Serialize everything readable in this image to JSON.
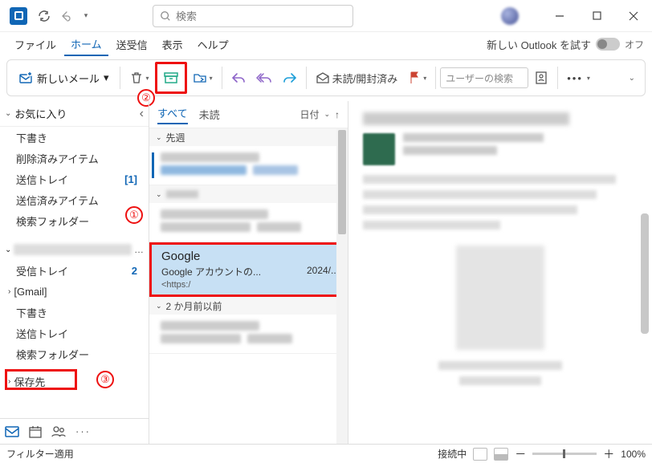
{
  "title": {
    "search_placeholder": "検索"
  },
  "menubar": {
    "file": "ファイル",
    "home": "ホーム",
    "sendrecv": "送受信",
    "view": "表示",
    "help": "ヘルプ",
    "try_new": "新しい Outlook を試す",
    "toggle_off": "オフ"
  },
  "ribbon": {
    "new_mail": "新しいメール",
    "unread_read": "未読/開封済み",
    "user_search_placeholder": "ユーザーの検索"
  },
  "sidebar": {
    "favorites": "お気に入り",
    "items_fav": [
      {
        "label": "下書き"
      },
      {
        "label": "削除済みアイテム"
      },
      {
        "label": "送信トレイ",
        "badge": "[1]"
      },
      {
        "label": "送信済みアイテム"
      },
      {
        "label": "検索フォルダー"
      }
    ],
    "account_items": [
      {
        "label": "受信トレイ",
        "badge": "2",
        "bold": true
      },
      {
        "label": "[Gmail]",
        "chev": true
      },
      {
        "label": "下書き"
      },
      {
        "label": "送信トレイ"
      },
      {
        "label": "検索フォルダー"
      }
    ],
    "archive_root": "保存先"
  },
  "msglist": {
    "tab_all": "すべて",
    "tab_unread": "未読",
    "sort_by": "日付",
    "sec_lastweek": "先週",
    "selected": {
      "sender": "Google",
      "subject": "Google アカウントの...",
      "date": "2024/...",
      "preview": "<https:/"
    },
    "sec_2months": "2 か月前以前"
  },
  "status": {
    "filter": "フィルター適用",
    "connected": "接続中",
    "zoom": "100%"
  },
  "anno": {
    "n1": "①",
    "n2": "②",
    "n3": "③"
  }
}
